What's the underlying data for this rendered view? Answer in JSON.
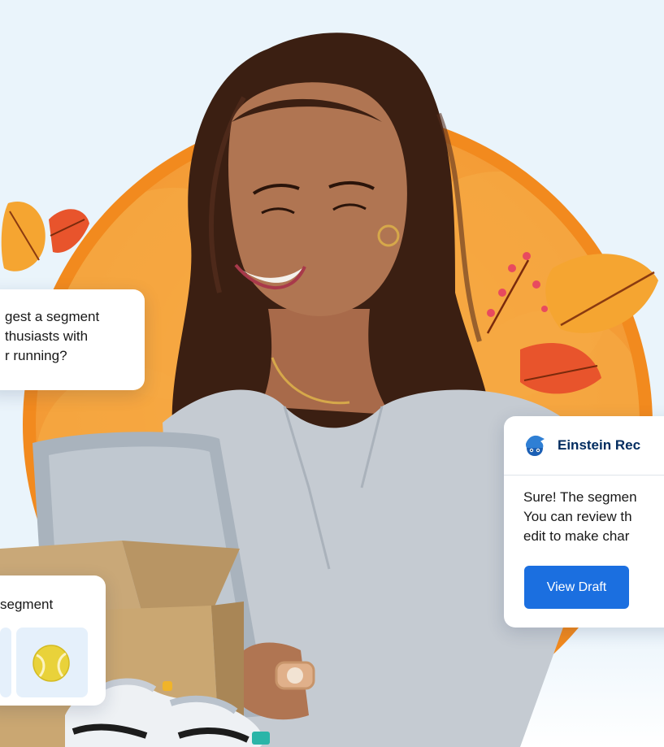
{
  "query_card": {
    "lines": [
      "gest a segment",
      "thusiasts with",
      "r running?"
    ]
  },
  "einstein_card": {
    "icon": "einstein-mascot-icon",
    "title": "Einstein Rec",
    "message_lines": [
      "Sure! The segmen",
      "You can review th",
      "edit to make char"
    ],
    "button_label": "View Draft"
  },
  "segment_card": {
    "label": "segment",
    "tile_icon": "tennis-ball-icon"
  },
  "colors": {
    "ring": "#f28a1e",
    "disc": "#f5a13a",
    "button": "#1b6fe0",
    "einstein_title": "#032d60",
    "background": "#eaf4fb"
  }
}
